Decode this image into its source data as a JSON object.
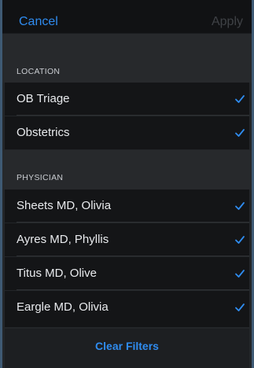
{
  "navbar": {
    "cancel_label": "Cancel",
    "apply_label": "Apply"
  },
  "location": {
    "header": "LOCATION",
    "items": [
      {
        "label": "OB Triage",
        "checked": true
      },
      {
        "label": "Obstetrics",
        "checked": true
      }
    ]
  },
  "physician": {
    "header": "PHYSICIAN",
    "items": [
      {
        "label": "Sheets MD, Olivia",
        "checked": true
      },
      {
        "label": "Ayres MD, Phyllis",
        "checked": true
      },
      {
        "label": "Titus MD, Olive",
        "checked": true
      },
      {
        "label": "Eargle MD, Olivia",
        "checked": true
      }
    ]
  },
  "footer": {
    "clear_label": "Clear Filters"
  },
  "colors": {
    "accent": "#2f8cf0",
    "disabled": "#3f4246",
    "row_bg": "#141517",
    "section_bg": "#27292c"
  }
}
